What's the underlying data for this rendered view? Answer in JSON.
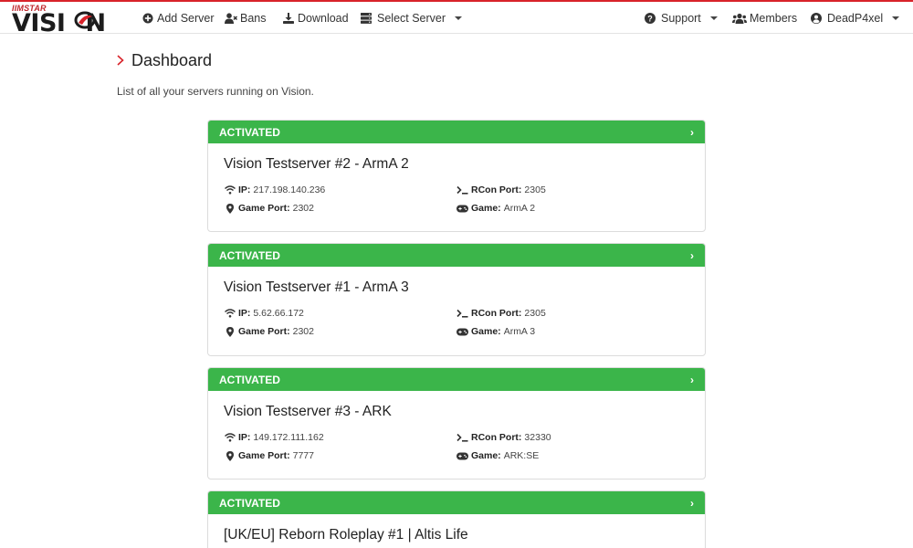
{
  "brand": {
    "sup": "IIMSTAR",
    "word": "VISI",
    "word_end": "N"
  },
  "nav": {
    "add_server": "Add Server",
    "bans": "Bans",
    "download": "Download",
    "select_server": "Select Server",
    "support": "Support",
    "members": "Members",
    "user": "DeadP4xel"
  },
  "page": {
    "title": "Dashboard",
    "subtitle": "List of all your servers running on Vision."
  },
  "labels": {
    "ip": "IP:",
    "game_port": "Game Port:",
    "rcon_port": "RCon Port:",
    "game": "Game:"
  },
  "servers": [
    {
      "status": "ACTIVATED",
      "name": "Vision Testserver #2 - ArmA 2",
      "ip": "217.198.140.236",
      "game_port": "2302",
      "rcon_port": "2305",
      "game": "ArmA 2"
    },
    {
      "status": "ACTIVATED",
      "name": "Vision Testserver #1 - ArmA 3",
      "ip": "5.62.66.172",
      "game_port": "2302",
      "rcon_port": "2305",
      "game": "ArmA 3"
    },
    {
      "status": "ACTIVATED",
      "name": "Vision Testserver #3 - ARK",
      "ip": "149.172.111.162",
      "game_port": "7777",
      "rcon_port": "32330",
      "game": "ARK:SE"
    },
    {
      "status": "ACTIVATED",
      "name": "[UK/EU] Reborn Roleplay #1 | Altis Life"
    }
  ],
  "colors": {
    "accent": "#d8232a",
    "activated": "#3bb54a"
  },
  "icons": [
    "plus-circle-icon",
    "user-ban-icon",
    "download-icon",
    "server-icon",
    "question-circle-icon",
    "users-icon",
    "user-circle-icon",
    "wifi-icon",
    "map-marker-icon",
    "terminal-icon",
    "gamepad-icon",
    "chevron-right-icon"
  ]
}
